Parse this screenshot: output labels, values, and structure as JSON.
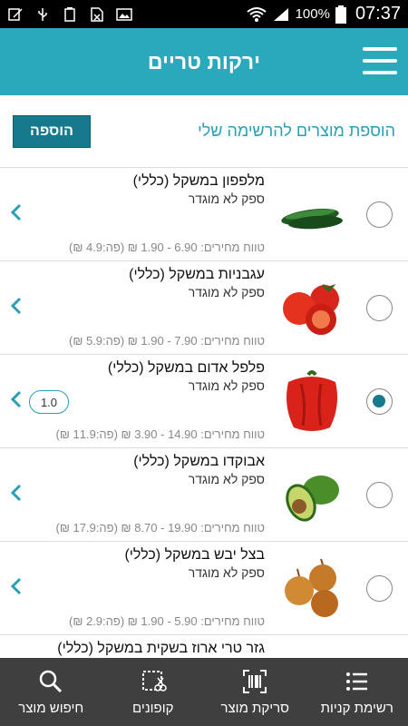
{
  "status_bar": {
    "battery_percent": "100%",
    "time": "07:37"
  },
  "header": {
    "title": "ירקות טריים"
  },
  "add_bar": {
    "label": "הוספת מוצרים להרשימה שלי",
    "button": "הוספה"
  },
  "items": [
    {
      "name": "מלפפון במשקל (כללי)",
      "supplier": "ספק לא מוגדר",
      "price_range": "טווח מחירים: 6.90 - 1.90 ₪ (פה:4.9 ₪)",
      "selected": false,
      "icon": "cucumber-image"
    },
    {
      "name": "עגבניות במשקל (כללי)",
      "supplier": "ספק לא מוגדר",
      "price_range": "טווח מחירים: 7.90 - 1.90 ₪ (פה:5.9 ₪)",
      "selected": false,
      "icon": "tomato-image"
    },
    {
      "name": "פלפל אדום במשקל (כללי)",
      "supplier": "ספק לא מוגדר",
      "price_range": "טווח מחירים: 14.90 - 3.90 ₪ (פה:11.9 ₪)",
      "selected": true,
      "quantity": "1.0",
      "icon": "red-pepper-image"
    },
    {
      "name": "אבוקדו במשקל (כללי)",
      "supplier": "ספק לא מוגדר",
      "price_range": "טווח מחירים: 19.90 - 8.70 ₪ (פה:17.9 ₪)",
      "selected": false,
      "icon": "avocado-image"
    },
    {
      "name": "בצל יבש במשקל (כללי)",
      "supplier": "ספק לא מוגדר",
      "price_range": "טווח מחירים: 5.90 - 1.90 ₪ (פה:2.9 ₪)",
      "selected": false,
      "icon": "onion-image"
    },
    {
      "name": "גזר טרי ארוז בשקית במשקל (כללי)",
      "supplier": "",
      "price_range": "",
      "selected": false,
      "icon": "carrot-image"
    }
  ],
  "bottom_nav": [
    {
      "label": "חיפוש מוצר",
      "icon": "search-icon"
    },
    {
      "label": "קופונים",
      "icon": "coupon-icon"
    },
    {
      "label": "סריקת מוצר",
      "icon": "barcode-scan-icon"
    },
    {
      "label": "רשימת קניות",
      "icon": "list-icon"
    }
  ],
  "colors": {
    "header_bg": "#2aa9bc",
    "accent": "#16798e",
    "nav_bg": "#3f3f3f"
  }
}
